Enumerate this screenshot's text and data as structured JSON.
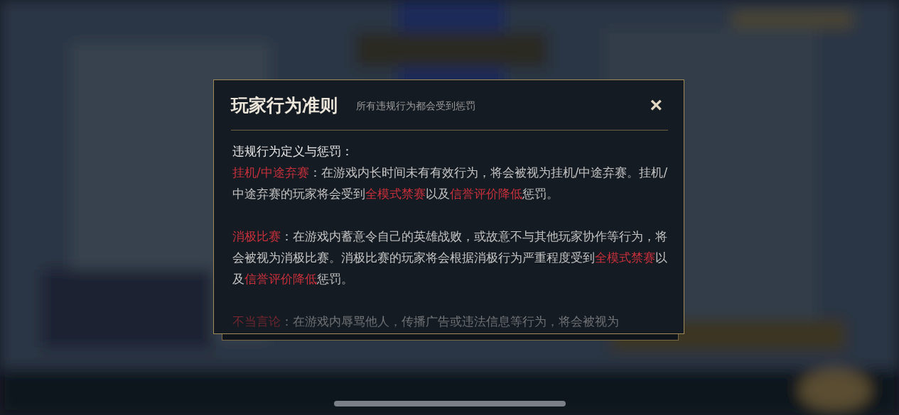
{
  "dialog": {
    "title": "玩家行为准则",
    "subtitle": "所有违规行为都会受到惩罚",
    "close": "×",
    "heading": "违规行为定义与惩罚：",
    "paragraphs": [
      [
        {
          "kind": "highlight",
          "text": "挂机/中途弃赛"
        },
        {
          "kind": "normal",
          "text": "：在游戏内长时间未有有效行为，将会被视为挂机/中途弃赛。挂机/中途弃赛的玩家将会受到"
        },
        {
          "kind": "highlight",
          "text": "全模式禁赛"
        },
        {
          "kind": "normal",
          "text": "以及"
        },
        {
          "kind": "highlight",
          "text": "信誉评价降低"
        },
        {
          "kind": "normal",
          "text": "惩罚。"
        }
      ],
      [
        {
          "kind": "highlight",
          "text": "消极比赛"
        },
        {
          "kind": "normal",
          "text": "：在游戏内蓄意令自己的英雄战败，或故意不与其他玩家协作等行为，将会被视为消极比赛。消极比赛的玩家将会根据消极行为严重程度受到"
        },
        {
          "kind": "highlight",
          "text": "全模式禁赛"
        },
        {
          "kind": "normal",
          "text": "以及"
        },
        {
          "kind": "highlight",
          "text": "信誉评价降低"
        },
        {
          "kind": "normal",
          "text": "惩罚。"
        }
      ],
      [
        {
          "kind": "highlight",
          "text": "不当言论"
        },
        {
          "kind": "normal",
          "text": "：在游戏内辱骂他人，传播广告或违法信息等行为，将会被视为"
        }
      ]
    ]
  }
}
